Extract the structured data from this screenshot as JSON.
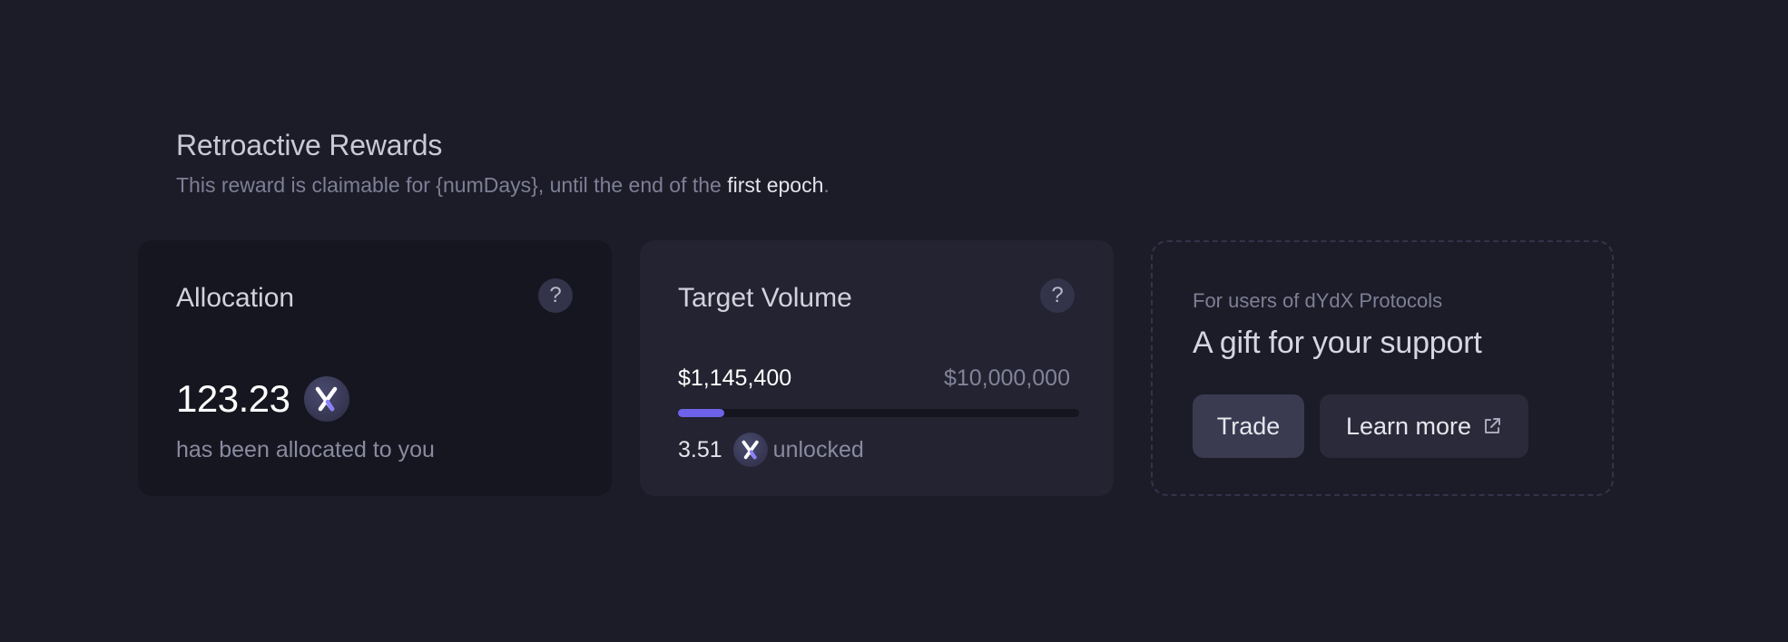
{
  "header": {
    "title": "Retroactive Rewards",
    "subtitle_pre": "This reward is claimable for {numDays}, until the end of the ",
    "subtitle_highlight": "first epoch",
    "subtitle_post": "."
  },
  "allocation": {
    "title": "Allocation",
    "help": "?",
    "amount": "123.23",
    "token_icon": "dydx-token-icon",
    "subtitle": "has been allocated to you"
  },
  "target_volume": {
    "title": "Target Volume",
    "help": "?",
    "current": "$1,145,400",
    "target": "$10,000,000",
    "progress": 0.1145,
    "unlocked_amount": "3.51",
    "unlocked_label": "unlocked",
    "accent": "#6e62ea"
  },
  "gift": {
    "kicker": "For users of dYdX Protocols",
    "title": "A gift for your support",
    "trade_label": "Trade",
    "learn_label": "Learn more",
    "learn_icon": "external-link-icon"
  }
}
